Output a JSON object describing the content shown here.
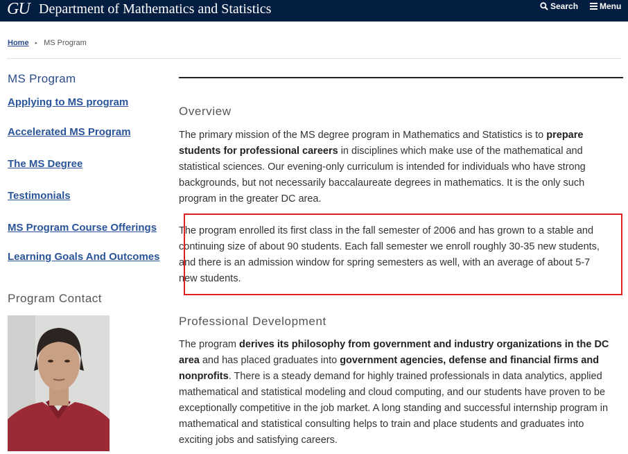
{
  "header": {
    "logo": "GU",
    "title": "Department of Mathematics and Statistics",
    "search_label": "Search",
    "menu_label": "Menu"
  },
  "breadcrumb": {
    "home": "Home",
    "current": "MS Program"
  },
  "sidebar": {
    "title": "MS Program",
    "links": [
      "Applying to MS program",
      "Accelerated MS Program",
      "The MS Degree",
      "Testimonials",
      "MS Program Course Offerings",
      "Learning Goals And Outcomes"
    ],
    "contact_title": "Program Contact"
  },
  "main": {
    "overview_heading": "Overview",
    "overview_lines": [
      [
        "The primary mission of the MS degree program in Mathematics and Statistics is to ",
        "prepare"
      ],
      [
        "students for professional careers",
        " in disciplines which make use of the mathematical and"
      ],
      [
        "statistical sciences. Our evening-only curriculum is intended for individuals who have strong"
      ],
      [
        "backgrounds, but not necessarily baccalaureate degrees in mathematics. It is the only such"
      ],
      [
        "program in the greater DC area."
      ]
    ],
    "enroll_lines": [
      "The program enrolled its first class in the fall semester of 2006 and has grown to a stable and",
      "continuing size of about 90 students. Each fall semester we enroll roughly 30-35 new students,",
      "and there is an admission window for spring semesters as well, with an average of about 5-7",
      "new students."
    ],
    "prof_heading": "Professional Development",
    "prof_p1_a": "The program ",
    "prof_p1_b": "derives its philosophy from government and industry organizations in the DC",
    "prof_p2_a": "area",
    "prof_p2_b": " and has placed graduates into ",
    "prof_p2_c": "government agencies, defense and financial firms and",
    "prof_p3_a": "nonprofits",
    "prof_p3_b": ". There is a steady demand for highly trained professionals in data analytics, applied",
    "prof_rest": [
      "mathematical and statistical modeling and cloud computing, and our students have proven to be",
      "exceptionally competitive in the job market. A long standing and successful internship program in",
      "mathematical and statistical consulting helps to train and place students and graduates into",
      "exciting jobs and satisfying careers."
    ]
  },
  "colors": {
    "header_bg": "#041e42",
    "link": "#2a5599",
    "highlight_border": "#e02020"
  }
}
